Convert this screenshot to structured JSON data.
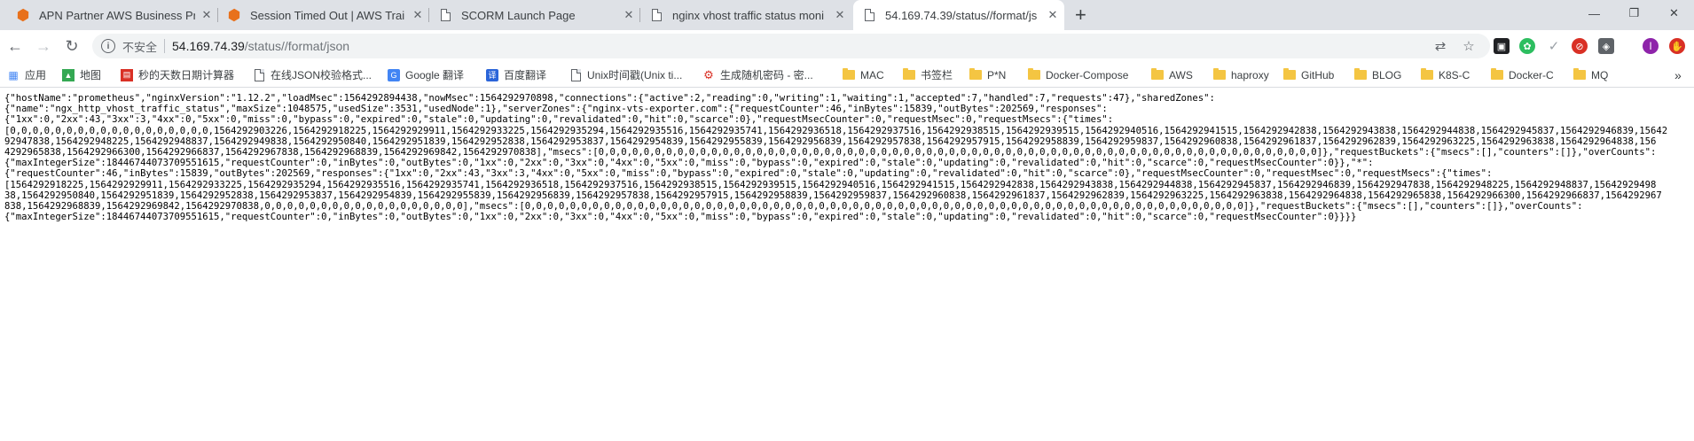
{
  "tabs": [
    {
      "title": "APN Partner AWS Business Pro",
      "icon": "aws-icon"
    },
    {
      "title": "Session Timed Out | AWS Trai",
      "icon": "aws-icon"
    },
    {
      "title": "SCORM Launch Page",
      "icon": "document-icon"
    },
    {
      "title": "nginx vhost traffic status moni",
      "icon": "document-icon"
    },
    {
      "title": "54.169.74.39/status//format/js",
      "icon": "document-icon",
      "active": true
    }
  ],
  "newtab_label": "+",
  "window_controls": {
    "minimize": "—",
    "restore": "❐",
    "close": "✕"
  },
  "address_bar": {
    "security_label": "不安全",
    "host": "54.169.74.39",
    "path": "/status//format/json"
  },
  "bookmarks": [
    {
      "label": "应用",
      "icon": "apps-icon"
    },
    {
      "label": "地图",
      "icon": "maps-icon"
    },
    {
      "label": "秒的天数日期计算器",
      "icon": "calculator-icon"
    },
    {
      "label": "在线JSON校验格式...",
      "icon": "page-icon"
    },
    {
      "label": "Google 翻译",
      "icon": "translate-icon"
    },
    {
      "label": "百度翻译",
      "icon": "baidu-translate-icon"
    },
    {
      "label": "Unix时间戳(Unix ti...",
      "icon": "page-icon"
    },
    {
      "label": "生成随机密码 - 密...",
      "icon": "gear-icon"
    },
    {
      "label": "MAC",
      "icon": "folder-icon"
    },
    {
      "label": "书签栏",
      "icon": "folder-icon"
    },
    {
      "label": "P*N",
      "icon": "folder-icon"
    },
    {
      "label": "Docker-Compose",
      "icon": "folder-icon"
    },
    {
      "label": "AWS",
      "icon": "folder-icon"
    },
    {
      "label": "haproxy",
      "icon": "folder-icon"
    },
    {
      "label": "GitHub",
      "icon": "folder-icon"
    },
    {
      "label": "BLOG",
      "icon": "folder-icon"
    },
    {
      "label": "K8S-C",
      "icon": "folder-icon"
    },
    {
      "label": "Docker-C",
      "icon": "folder-icon"
    },
    {
      "label": "MQ",
      "icon": "folder-icon"
    }
  ],
  "bookmarks_overflow": "»",
  "profile_initial": "I",
  "json_lines": [
    "{\"hostName\":\"prometheus\",\"nginxVersion\":\"1.12.2\",\"loadMsec\":1564292894438,\"nowMsec\":1564292970898,\"connections\":{\"active\":2,\"reading\":0,\"writing\":1,\"waiting\":1,\"accepted\":7,\"handled\":7,\"requests\":47},\"sharedZones\":",
    "{\"name\":\"ngx_http_vhost_traffic_status\",\"maxSize\":1048575,\"usedSize\":3531,\"usedNode\":1},\"serverZones\":{\"nginx-vts-exporter.com\":{\"requestCounter\":46,\"inBytes\":15839,\"outBytes\":202569,\"responses\":",
    "{\"1xx\":0,\"2xx\":43,\"3xx\":3,\"4xx\":0,\"5xx\":0,\"miss\":0,\"bypass\":0,\"expired\":0,\"stale\":0,\"updating\":0,\"revalidated\":0,\"hit\":0,\"scarce\":0},\"requestMsecCounter\":0,\"requestMsec\":0,\"requestMsecs\":{\"times\":",
    "[0,0,0,0,0,0,0,0,0,0,0,0,0,0,0,0,0,0,1564292903226,1564292918225,1564292929911,1564292933225,1564292935294,1564292935516,1564292935741,1564292936518,1564292937516,1564292938515,1564292939515,1564292940516,1564292941515,1564292942838,1564292943838,1564292944838,1564292945837,1564292946839,15642",
    "92947838,1564292948225,1564292948837,1564292949838,1564292950840,1564292951839,1564292952838,1564292953837,1564292954839,1564292955839,1564292956839,1564292957838,1564292957915,1564292958839,1564292959837,1564292960838,1564292961837,1564292962839,1564292963225,1564292963838,1564292964838,156",
    "4292965838,1564292966300,1564292966837,1564292967838,1564292968839,1564292969842,1564292970838],\"msecs\":[0,0,0,0,0,0,0,0,0,0,0,0,0,0,0,0,0,0,0,0,0,0,0,0,0,0,0,0,0,0,0,0,0,0,0,0,0,0,0,0,0,0,0,0,0,0,0,0,0,0,0,0,0,0,0,0,0,0,0,0,0,0,0,0]},\"requestBuckets\":{\"msecs\":[],\"counters\":[]},\"overCounts\":",
    "{\"maxIntegerSize\":18446744073709551615,\"requestCounter\":0,\"inBytes\":0,\"outBytes\":0,\"1xx\":0,\"2xx\":0,\"3xx\":0,\"4xx\":0,\"5xx\":0,\"miss\":0,\"bypass\":0,\"expired\":0,\"stale\":0,\"updating\":0,\"revalidated\":0,\"hit\":0,\"scarce\":0,\"requestMsecCounter\":0}},\"*\":",
    "{\"requestCounter\":46,\"inBytes\":15839,\"outBytes\":202569,\"responses\":{\"1xx\":0,\"2xx\":43,\"3xx\":3,\"4xx\":0,\"5xx\":0,\"miss\":0,\"bypass\":0,\"expired\":0,\"stale\":0,\"updating\":0,\"revalidated\":0,\"hit\":0,\"scarce\":0},\"requestMsecCounter\":0,\"requestMsec\":0,\"requestMsecs\":{\"times\":",
    "[1564292918225,1564292929911,1564292933225,1564292935294,1564292935516,1564292935741,1564292936518,1564292937516,1564292938515,1564292939515,1564292940516,1564292941515,1564292942838,1564292943838,1564292944838,1564292945837,1564292946839,1564292947838,1564292948225,1564292948837,15642929498",
    "38,1564292950840,1564292951839,1564292952838,1564292953837,1564292954839,1564292955839,1564292956839,1564292957838,1564292957915,1564292958839,1564292959837,1564292960838,1564292961837,1564292962839,1564292963225,1564292963838,1564292964838,1564292965838,1564292966300,1564292966837,1564292967",
    "838,1564292968839,1564292969842,1564292970838,0,0,0,0,0,0,0,0,0,0,0,0,0,0,0,0,0,0],\"msecs\":[0,0,0,0,0,0,0,0,0,0,0,0,0,0,0,0,0,0,0,0,0,0,0,0,0,0,0,0,0,0,0,0,0,0,0,0,0,0,0,0,0,0,0,0,0,0,0,0,0,0,0,0,0,0,0,0,0,0,0,0,0,0,0,0]},\"requestBuckets\":{\"msecs\":[],\"counters\":[]},\"overCounts\":",
    "{\"maxIntegerSize\":18446744073709551615,\"requestCounter\":0,\"inBytes\":0,\"outBytes\":0,\"1xx\":0,\"2xx\":0,\"3xx\":0,\"4xx\":0,\"5xx\":0,\"miss\":0,\"bypass\":0,\"expired\":0,\"stale\":0,\"updating\":0,\"revalidated\":0,\"hit\":0,\"scarce\":0,\"requestMsecCounter\":0}}}}"
  ]
}
